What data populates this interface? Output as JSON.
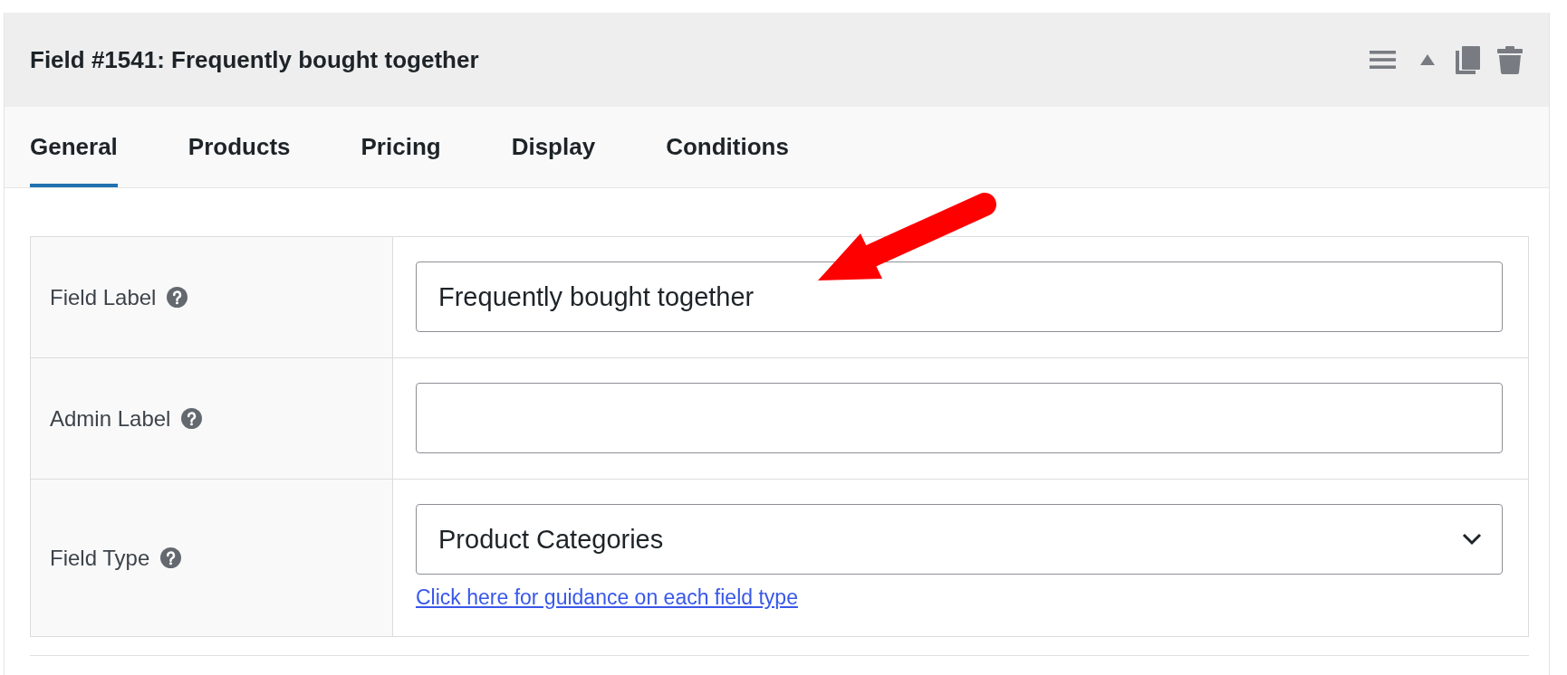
{
  "panel": {
    "title": "Field #1541: Frequently bought together"
  },
  "tabs": [
    {
      "label": "General",
      "selected": true
    },
    {
      "label": "Products",
      "selected": false
    },
    {
      "label": "Pricing",
      "selected": false
    },
    {
      "label": "Display",
      "selected": false
    },
    {
      "label": "Conditions",
      "selected": false
    }
  ],
  "fields": [
    {
      "kind": "text",
      "label": "Field Label",
      "value": "Frequently bought together"
    },
    {
      "kind": "text",
      "label": "Admin Label"
    },
    {
      "kind": "select",
      "label": "Field Type",
      "value": "Product Categories",
      "link": "Click here for guidance on each field type"
    }
  ]
}
